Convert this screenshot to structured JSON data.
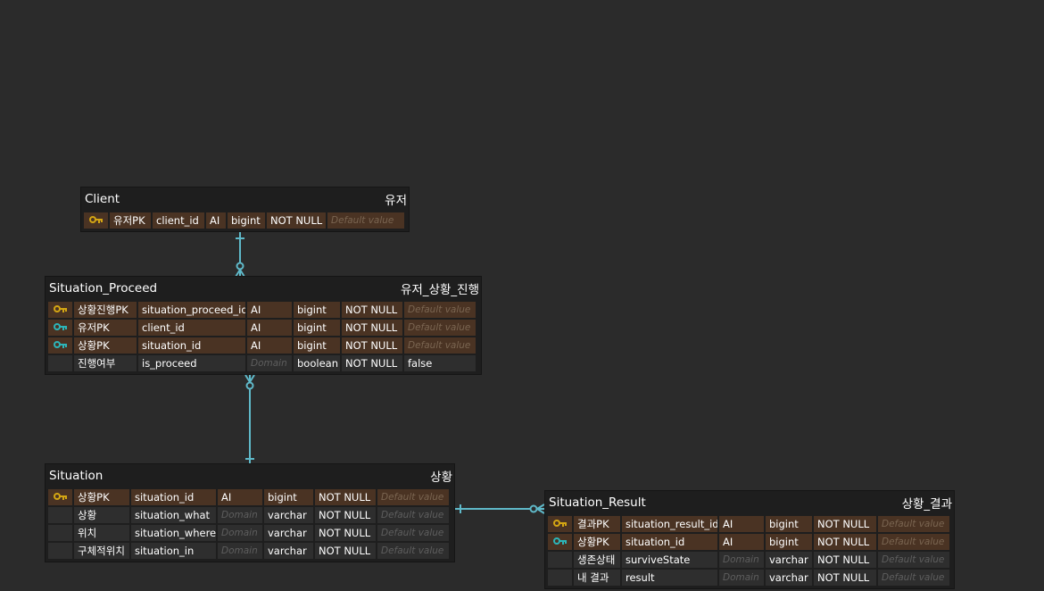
{
  "colors": {
    "background": "#2b2b2b",
    "entity_bg": "#1e1e1e",
    "key_row_bg": "#4a3323",
    "row_bg": "#2e2e2e",
    "primary_key_icon": "#d4a613",
    "foreign_key_icon": "#2cb5b9",
    "relation_line": "#5fb9c9"
  },
  "entities": {
    "client": {
      "title": "Client",
      "alias": "유저",
      "rows": [
        {
          "key": "primary-key-icon",
          "logical": "유저PK",
          "physical": "client_id",
          "domain": "AI",
          "type": "bigint",
          "nullable": "NOT NULL",
          "default": "Default value"
        }
      ]
    },
    "situation_proceed": {
      "title": "Situation_Proceed",
      "alias": "유저_상황_진행",
      "rows": [
        {
          "key": "primary-key-icon",
          "logical": "상황진행PK",
          "physical": "situation_proceed_id",
          "domain": "AI",
          "type": "bigint",
          "nullable": "NOT NULL",
          "default": "Default value"
        },
        {
          "key": "foreign-key-icon",
          "logical": "유저PK",
          "physical": "client_id",
          "domain": "AI",
          "type": "bigint",
          "nullable": "NOT NULL",
          "default": "Default value"
        },
        {
          "key": "foreign-key-icon",
          "logical": "상황PK",
          "physical": "situation_id",
          "domain": "AI",
          "type": "bigint",
          "nullable": "NOT NULL",
          "default": "Default value"
        },
        {
          "key": "",
          "logical": "진행여부",
          "physical": "is_proceed",
          "domain": "Domain",
          "type": "boolean",
          "nullable": "NOT NULL",
          "default": "false"
        }
      ]
    },
    "situation": {
      "title": "Situation",
      "alias": "상황",
      "rows": [
        {
          "key": "primary-key-icon",
          "logical": "상황PK",
          "physical": "situation_id",
          "domain": "AI",
          "type": "bigint",
          "nullable": "NOT NULL",
          "default": "Default value"
        },
        {
          "key": "",
          "logical": "상황",
          "physical": "situation_what",
          "domain": "Domain",
          "type": "varchar",
          "nullable": "NOT NULL",
          "default": "Default value"
        },
        {
          "key": "",
          "logical": "위치",
          "physical": "situation_where",
          "domain": "Domain",
          "type": "varchar",
          "nullable": "NOT NULL",
          "default": "Default value"
        },
        {
          "key": "",
          "logical": "구체적위치",
          "physical": "situation_in",
          "domain": "Domain",
          "type": "varchar",
          "nullable": "NOT NULL",
          "default": "Default value"
        }
      ]
    },
    "situation_result": {
      "title": "Situation_Result",
      "alias": "상황_결과",
      "rows": [
        {
          "key": "primary-key-icon",
          "logical": "결과PK",
          "physical": "situation_result_id",
          "domain": "AI",
          "type": "bigint",
          "nullable": "NOT NULL",
          "default": "Default value"
        },
        {
          "key": "foreign-key-icon",
          "logical": "상황PK",
          "physical": "situation_id",
          "domain": "AI",
          "type": "bigint",
          "nullable": "NOT NULL",
          "default": "Default value"
        },
        {
          "key": "",
          "logical": "생존상태",
          "physical": "surviveState",
          "domain": "Domain",
          "type": "varchar",
          "nullable": "NOT NULL",
          "default": "Default value"
        },
        {
          "key": "",
          "logical": "내 결과",
          "physical": "result",
          "domain": "Domain",
          "type": "varchar",
          "nullable": "NOT NULL",
          "default": "Default value"
        }
      ]
    }
  },
  "relations": [
    {
      "from": "Client",
      "to": "Situation_Proceed",
      "kind": "one-to-zero-or-many"
    },
    {
      "from": "Situation",
      "to": "Situation_Proceed",
      "kind": "one-to-zero-or-many"
    },
    {
      "from": "Situation",
      "to": "Situation_Result",
      "kind": "one-to-zero-or-one"
    }
  ]
}
